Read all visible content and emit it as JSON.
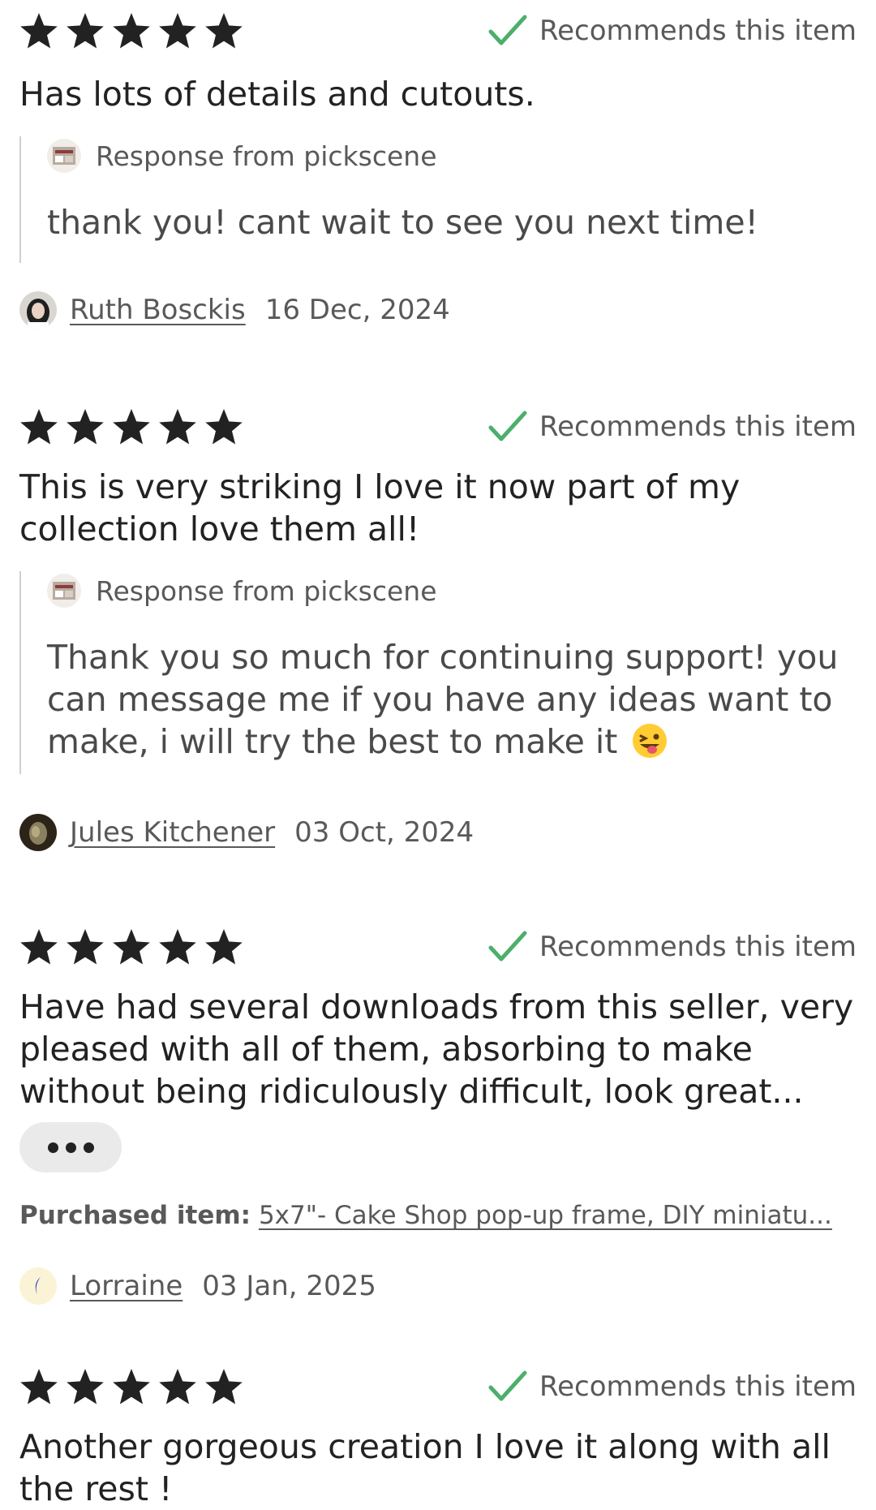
{
  "reviews": [
    {
      "rating": 5,
      "recommend_label": "Recommends this item",
      "text": "Has lots of details and cutouts.",
      "response": {
        "title": "Response from pickscene",
        "text": "thank you! cant wait to see you next time!"
      },
      "reviewer": "Ruth Bosckis",
      "date": "16 Dec, 2024"
    },
    {
      "rating": 5,
      "recommend_label": "Recommends this item",
      "text": "This is very striking I love it now part of my collection love them all!",
      "response": {
        "title": "Response from pickscene",
        "text": "Thank you so much for continuing support! you can message me if you have any ideas want to make, i will try the best to make it",
        "emoji": "winking-face-with-tongue-icon"
      },
      "reviewer": "Jules Kitchener",
      "date": "03 Oct, 2024"
    },
    {
      "rating": 5,
      "recommend_label": "Recommends this item",
      "text": "Have had several downloads from this seller, very pleased with all of them, absorbing to make without being ridiculously difficult, look great...",
      "more_button_icon": "more-dots-icon",
      "purchased_label": "Purchased item:",
      "purchased_item": "5x7\"- Cake Shop pop-up frame, DIY miniatu...",
      "reviewer": "Lorraine",
      "date": "03 Jan, 2025"
    },
    {
      "rating": 5,
      "recommend_label": "Recommends this item",
      "text": "Another gorgeous creation I love it along with all the rest !"
    }
  ],
  "colors": {
    "star": "#222222",
    "check": "#4caf6a",
    "muted_text": "#595959",
    "divider": "#cfcfcf",
    "more_button_bg": "#eaeaea"
  }
}
